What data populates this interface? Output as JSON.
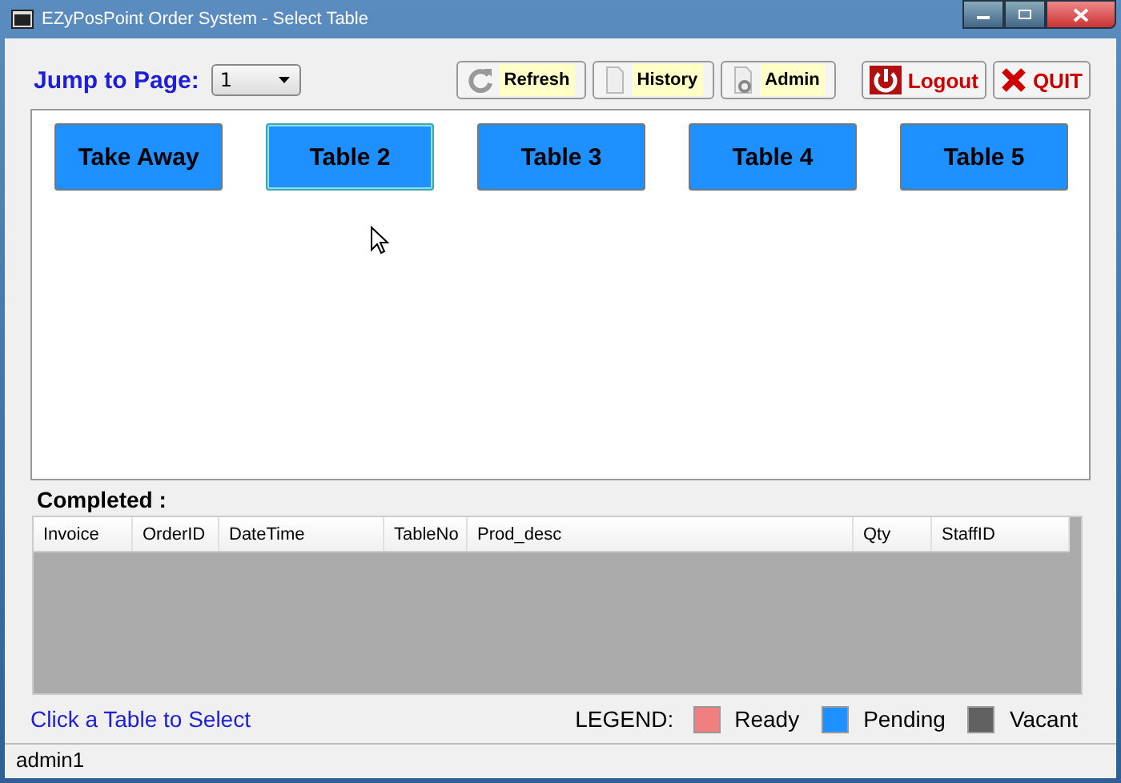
{
  "window": {
    "title": "EZyPosPoint Order System - Select Table"
  },
  "toolbar": {
    "jump_label": "Jump to Page:",
    "page_select": "1",
    "buttons": [
      {
        "label": "Refresh",
        "kind": "refresh"
      },
      {
        "label": "History",
        "kind": "history"
      },
      {
        "label": "Admin",
        "kind": "admin"
      },
      {
        "label": "Logout",
        "kind": "logout"
      },
      {
        "label": "QUIT",
        "kind": "quit"
      }
    ]
  },
  "tables": [
    {
      "label": "Take Away",
      "color": "#1e90ff",
      "selected": false
    },
    {
      "label": "Table 2",
      "color": "#1e90ff",
      "selected": true
    },
    {
      "label": "Table 3",
      "color": "#1e90ff",
      "selected": false
    },
    {
      "label": "Table 4",
      "color": "#1e90ff",
      "selected": false
    },
    {
      "label": "Table 5",
      "color": "#1e90ff",
      "selected": false
    }
  ],
  "completed": {
    "title": "Completed :",
    "columns": [
      "Invoice",
      "OrderID",
      "DateTime",
      "TableNo",
      "Prod_desc",
      "Qty",
      "StaffID"
    ]
  },
  "hint": "Click a Table to Select",
  "legend": {
    "label": "LEGEND:",
    "items": [
      {
        "label": "Ready",
        "color": "#f08080"
      },
      {
        "label": "Pending",
        "color": "#1e90ff"
      },
      {
        "label": "Vacant",
        "color": "#606060"
      }
    ]
  },
  "status_bar": {
    "user": "admin1"
  }
}
